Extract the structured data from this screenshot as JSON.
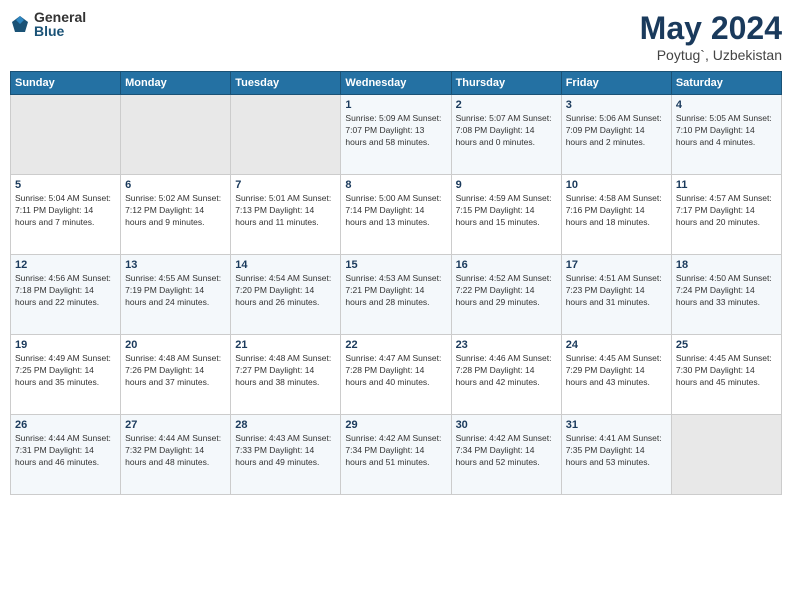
{
  "logo": {
    "general": "General",
    "blue": "Blue"
  },
  "title": "May 2024",
  "subtitle": "Poytug`, Uzbekistan",
  "days_header": [
    "Sunday",
    "Monday",
    "Tuesday",
    "Wednesday",
    "Thursday",
    "Friday",
    "Saturday"
  ],
  "weeks": [
    [
      {
        "num": "",
        "info": ""
      },
      {
        "num": "",
        "info": ""
      },
      {
        "num": "",
        "info": ""
      },
      {
        "num": "1",
        "info": "Sunrise: 5:09 AM\nSunset: 7:07 PM\nDaylight: 13 hours and 58 minutes."
      },
      {
        "num": "2",
        "info": "Sunrise: 5:07 AM\nSunset: 7:08 PM\nDaylight: 14 hours and 0 minutes."
      },
      {
        "num": "3",
        "info": "Sunrise: 5:06 AM\nSunset: 7:09 PM\nDaylight: 14 hours and 2 minutes."
      },
      {
        "num": "4",
        "info": "Sunrise: 5:05 AM\nSunset: 7:10 PM\nDaylight: 14 hours and 4 minutes."
      }
    ],
    [
      {
        "num": "5",
        "info": "Sunrise: 5:04 AM\nSunset: 7:11 PM\nDaylight: 14 hours and 7 minutes."
      },
      {
        "num": "6",
        "info": "Sunrise: 5:02 AM\nSunset: 7:12 PM\nDaylight: 14 hours and 9 minutes."
      },
      {
        "num": "7",
        "info": "Sunrise: 5:01 AM\nSunset: 7:13 PM\nDaylight: 14 hours and 11 minutes."
      },
      {
        "num": "8",
        "info": "Sunrise: 5:00 AM\nSunset: 7:14 PM\nDaylight: 14 hours and 13 minutes."
      },
      {
        "num": "9",
        "info": "Sunrise: 4:59 AM\nSunset: 7:15 PM\nDaylight: 14 hours and 15 minutes."
      },
      {
        "num": "10",
        "info": "Sunrise: 4:58 AM\nSunset: 7:16 PM\nDaylight: 14 hours and 18 minutes."
      },
      {
        "num": "11",
        "info": "Sunrise: 4:57 AM\nSunset: 7:17 PM\nDaylight: 14 hours and 20 minutes."
      }
    ],
    [
      {
        "num": "12",
        "info": "Sunrise: 4:56 AM\nSunset: 7:18 PM\nDaylight: 14 hours and 22 minutes."
      },
      {
        "num": "13",
        "info": "Sunrise: 4:55 AM\nSunset: 7:19 PM\nDaylight: 14 hours and 24 minutes."
      },
      {
        "num": "14",
        "info": "Sunrise: 4:54 AM\nSunset: 7:20 PM\nDaylight: 14 hours and 26 minutes."
      },
      {
        "num": "15",
        "info": "Sunrise: 4:53 AM\nSunset: 7:21 PM\nDaylight: 14 hours and 28 minutes."
      },
      {
        "num": "16",
        "info": "Sunrise: 4:52 AM\nSunset: 7:22 PM\nDaylight: 14 hours and 29 minutes."
      },
      {
        "num": "17",
        "info": "Sunrise: 4:51 AM\nSunset: 7:23 PM\nDaylight: 14 hours and 31 minutes."
      },
      {
        "num": "18",
        "info": "Sunrise: 4:50 AM\nSunset: 7:24 PM\nDaylight: 14 hours and 33 minutes."
      }
    ],
    [
      {
        "num": "19",
        "info": "Sunrise: 4:49 AM\nSunset: 7:25 PM\nDaylight: 14 hours and 35 minutes."
      },
      {
        "num": "20",
        "info": "Sunrise: 4:48 AM\nSunset: 7:26 PM\nDaylight: 14 hours and 37 minutes."
      },
      {
        "num": "21",
        "info": "Sunrise: 4:48 AM\nSunset: 7:27 PM\nDaylight: 14 hours and 38 minutes."
      },
      {
        "num": "22",
        "info": "Sunrise: 4:47 AM\nSunset: 7:28 PM\nDaylight: 14 hours and 40 minutes."
      },
      {
        "num": "23",
        "info": "Sunrise: 4:46 AM\nSunset: 7:28 PM\nDaylight: 14 hours and 42 minutes."
      },
      {
        "num": "24",
        "info": "Sunrise: 4:45 AM\nSunset: 7:29 PM\nDaylight: 14 hours and 43 minutes."
      },
      {
        "num": "25",
        "info": "Sunrise: 4:45 AM\nSunset: 7:30 PM\nDaylight: 14 hours and 45 minutes."
      }
    ],
    [
      {
        "num": "26",
        "info": "Sunrise: 4:44 AM\nSunset: 7:31 PM\nDaylight: 14 hours and 46 minutes."
      },
      {
        "num": "27",
        "info": "Sunrise: 4:44 AM\nSunset: 7:32 PM\nDaylight: 14 hours and 48 minutes."
      },
      {
        "num": "28",
        "info": "Sunrise: 4:43 AM\nSunset: 7:33 PM\nDaylight: 14 hours and 49 minutes."
      },
      {
        "num": "29",
        "info": "Sunrise: 4:42 AM\nSunset: 7:34 PM\nDaylight: 14 hours and 51 minutes."
      },
      {
        "num": "30",
        "info": "Sunrise: 4:42 AM\nSunset: 7:34 PM\nDaylight: 14 hours and 52 minutes."
      },
      {
        "num": "31",
        "info": "Sunrise: 4:41 AM\nSunset: 7:35 PM\nDaylight: 14 hours and 53 minutes."
      },
      {
        "num": "",
        "info": ""
      }
    ]
  ]
}
